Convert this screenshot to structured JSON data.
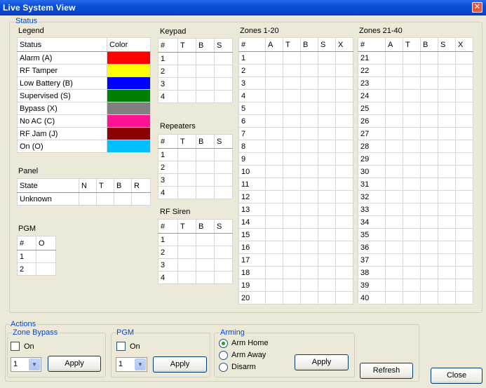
{
  "window": {
    "title": "Live System View",
    "close_glyph": "✕"
  },
  "status": {
    "group_label": "Status",
    "legend": {
      "label": "Legend",
      "headers": [
        "Status",
        "Color"
      ],
      "rows": [
        {
          "status": "Alarm (A)",
          "color": "#FF0000"
        },
        {
          "status": "RF Tamper",
          "color": "#FFFF00"
        },
        {
          "status": "Low Battery (B)",
          "color": "#0000FF"
        },
        {
          "status": "Supervised (S)",
          "color": "#008000"
        },
        {
          "status": "Bypass (X)",
          "color": "#808080"
        },
        {
          "status": "No AC (C)",
          "color": "#FF1493"
        },
        {
          "status": "RF Jam (J)",
          "color": "#8B0000"
        },
        {
          "status": "On (O)",
          "color": "#00BFFF"
        }
      ]
    },
    "panel": {
      "label": "Panel",
      "headers": [
        "State",
        "N",
        "T",
        "B",
        "R"
      ],
      "rows": [
        [
          "Unknown",
          "",
          "",
          "",
          ""
        ]
      ]
    },
    "pgm": {
      "label": "PGM",
      "headers": [
        "#",
        "O"
      ],
      "rows": [
        [
          "1",
          ""
        ],
        [
          "2",
          ""
        ]
      ]
    },
    "keypad": {
      "label": "Keypad",
      "headers": [
        "#",
        "T",
        "B",
        "S"
      ],
      "rows": [
        [
          "1",
          "",
          "",
          ""
        ],
        [
          "2",
          "",
          "",
          ""
        ],
        [
          "3",
          "",
          "",
          ""
        ],
        [
          "4",
          "",
          "",
          ""
        ]
      ]
    },
    "repeaters": {
      "label": "Repeaters",
      "headers": [
        "#",
        "T",
        "B",
        "S"
      ],
      "rows": [
        [
          "1",
          "",
          "",
          ""
        ],
        [
          "2",
          "",
          "",
          ""
        ],
        [
          "3",
          "",
          "",
          ""
        ],
        [
          "4",
          "",
          "",
          ""
        ]
      ]
    },
    "rf_siren": {
      "label": "RF Siren",
      "headers": [
        "#",
        "T",
        "B",
        "S"
      ],
      "rows": [
        [
          "1",
          "",
          "",
          ""
        ],
        [
          "2",
          "",
          "",
          ""
        ],
        [
          "3",
          "",
          "",
          ""
        ],
        [
          "4",
          "",
          "",
          ""
        ]
      ]
    },
    "zones_1_20": {
      "label": "Zones 1-20",
      "headers": [
        "#",
        "A",
        "T",
        "B",
        "S",
        "X"
      ],
      "numbers": [
        "1",
        "2",
        "3",
        "4",
        "5",
        "6",
        "7",
        "8",
        "9",
        "10",
        "11",
        "12",
        "13",
        "14",
        "15",
        "16",
        "17",
        "18",
        "19",
        "20"
      ]
    },
    "zones_21_40": {
      "label": "Zones 21-40",
      "headers": [
        "#",
        "A",
        "T",
        "B",
        "S",
        "X"
      ],
      "numbers": [
        "21",
        "22",
        "23",
        "24",
        "25",
        "26",
        "27",
        "28",
        "29",
        "30",
        "31",
        "32",
        "33",
        "34",
        "35",
        "36",
        "37",
        "38",
        "39",
        "40"
      ]
    }
  },
  "actions": {
    "group_label": "Actions",
    "zone_bypass": {
      "label": "Zone Bypass",
      "checkbox_label": "On",
      "selected": "1",
      "apply_label": "Apply"
    },
    "pgm": {
      "label": "PGM",
      "checkbox_label": "On",
      "selected": "1",
      "apply_label": "Apply"
    },
    "arming": {
      "label": "Arming",
      "options": [
        "Arm Home",
        "Arm Away",
        "Disarm"
      ],
      "selected_index": 0,
      "apply_label": "Apply"
    },
    "refresh_label": "Refresh",
    "close_label": "Close"
  }
}
